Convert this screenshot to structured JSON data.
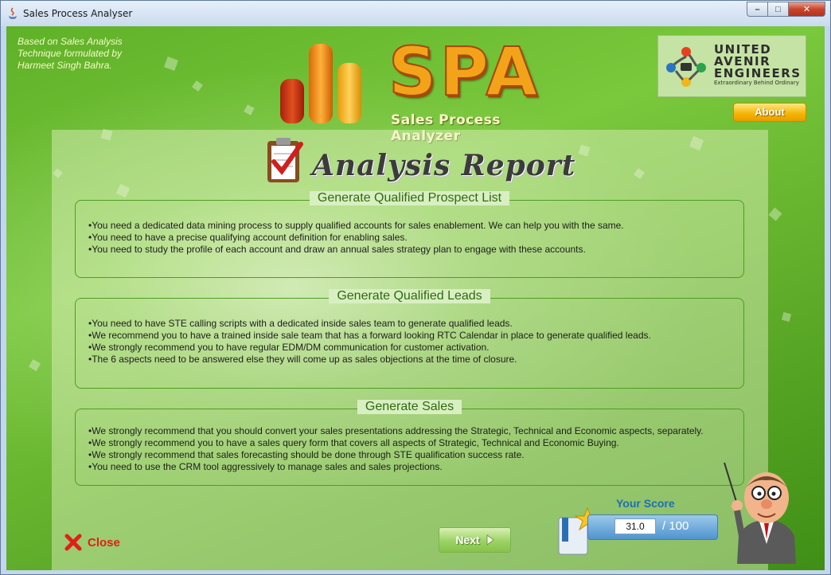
{
  "window": {
    "title": "Sales Process Analyser",
    "controls": {
      "minimize": "–",
      "maximize": "□",
      "close": "✕"
    }
  },
  "header": {
    "credit": "Based on Sales Analysis Technique formulated by Harmeet Singh Bahra.",
    "logo_text": "SPA",
    "logo_subtitle": "Sales Process Analyzer",
    "company": {
      "name_line1": "UNITED",
      "name_line2": "AVENIR",
      "name_line3": "ENGINEERS",
      "tagline": "Extraordinary  Behind  Ordinary"
    },
    "about_label": "About"
  },
  "report": {
    "title": "Analysis Report",
    "sections": [
      {
        "title": "Generate Qualified Prospect List",
        "items": [
          "You need a dedicated data mining process to supply qualified accounts for sales enablement. We can help you with the same.",
          "You need to have a precise qualifying account definition for enabling sales.",
          "You need to study the profile of each account and draw an annual sales strategy plan to engage with these accounts."
        ]
      },
      {
        "title": "Generate Qualified Leads",
        "items": [
          "You need to have STE calling scripts with a dedicated inside sales team to generate qualified leads.",
          "We recommend you to have a trained inside sale team that has a forward looking RTC Calendar in place to generate qualified leads.",
          "We strongly recommend you to have regular EDM/DM communication for customer activation.",
          "The 6 aspects need to be answered else they will come up as sales objections at the time of closure."
        ]
      },
      {
        "title": "Generate Sales",
        "items": [
          "We strongly recommend that you should convert your sales presentations addressing the Strategic, Technical and Economic aspects, separately.",
          "We strongly recommend you to have a sales query form that covers all aspects of Strategic, Technical and Economic Buying.",
          "We strongly recommend that sales forecasting should be done through STE qualification success rate.",
          "You need to use the CRM tool aggressively to manage sales and sales projections."
        ]
      }
    ]
  },
  "footer": {
    "close_label": "Close",
    "next_label": "Next",
    "score_label": "Your Score",
    "score_value": "31.0",
    "score_max": "/ 100"
  },
  "colors": {
    "background_green": "#6bbb31",
    "section_border": "#4f9e23",
    "section_title": "#2f6b0e",
    "close_red": "#e02018",
    "score_blue": "#1e6fb2",
    "about_gold": "#f5b400"
  }
}
